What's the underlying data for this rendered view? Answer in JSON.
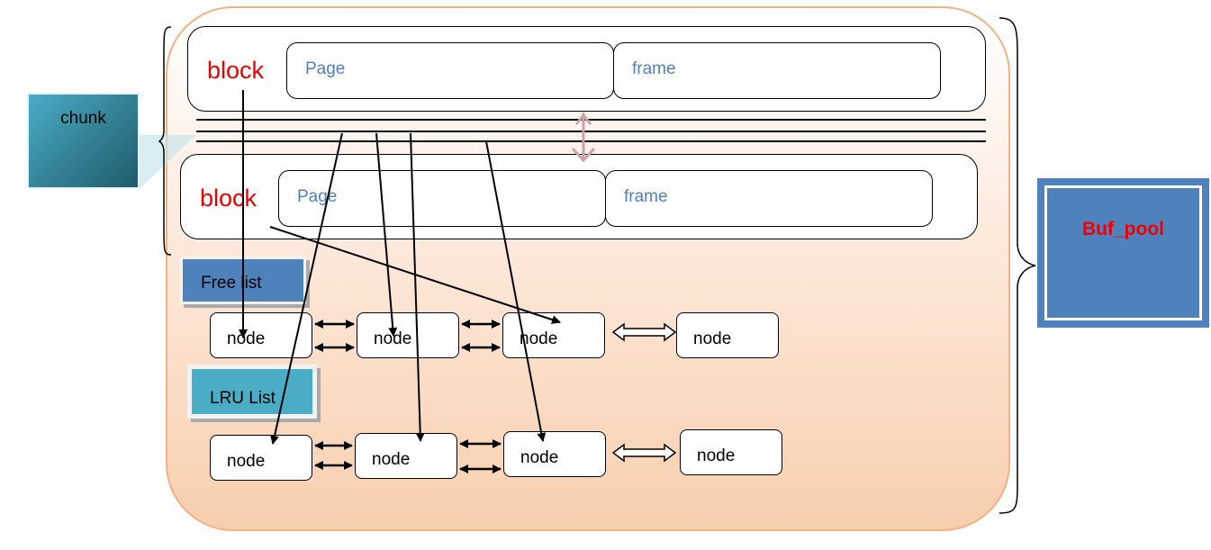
{
  "chunk": {
    "label": "chunk"
  },
  "blocks": [
    {
      "label": "block",
      "page": "Page",
      "frame": "frame"
    },
    {
      "label": "block",
      "page": "Page",
      "frame": "frame"
    }
  ],
  "free_list": {
    "label": "Free list",
    "nodes": [
      "node",
      "node",
      "node",
      "node"
    ]
  },
  "lru_list": {
    "label": "LRU List",
    "nodes": [
      "node",
      "node",
      "node",
      "node"
    ]
  },
  "buf_pool": {
    "label": "Buf_pool"
  },
  "colors": {
    "block_label": "#e00000",
    "page_text": "#4f81bd",
    "free_list": "#4f81bd",
    "lru_list": "#4bacc6",
    "buf_pool": "#4f81bd",
    "container": "#f8cfae"
  }
}
